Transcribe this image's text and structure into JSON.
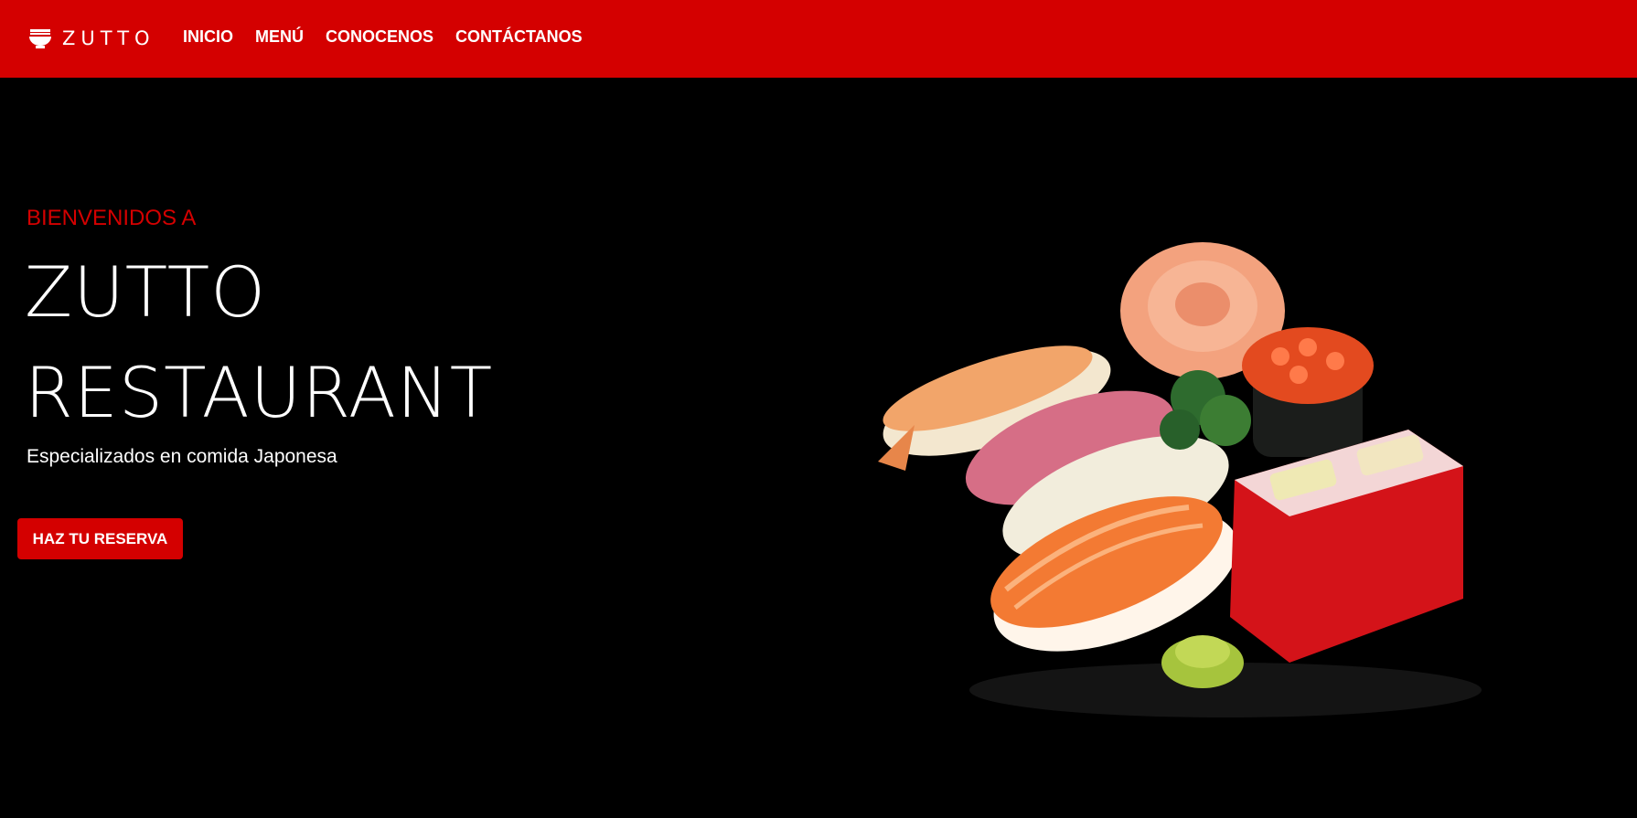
{
  "nav": {
    "brand": "ZUTTO",
    "brand_icon": "ramen-bowl-icon",
    "links": [
      "INICIO",
      "MENÚ",
      "CONOCENOS",
      "CONTÁCTANOS"
    ]
  },
  "hero": {
    "kicker": "BIENVENIDOS A",
    "title_line1": "ZUTTO",
    "title_line2": "RESTAURANT",
    "subtitle": "Especializados en comida Japonesa",
    "cta": "HAZ TU RESERVA",
    "image": "sushi-platter"
  },
  "colors": {
    "accent": "#d40000",
    "background": "#000000",
    "text": "#ffffff"
  }
}
